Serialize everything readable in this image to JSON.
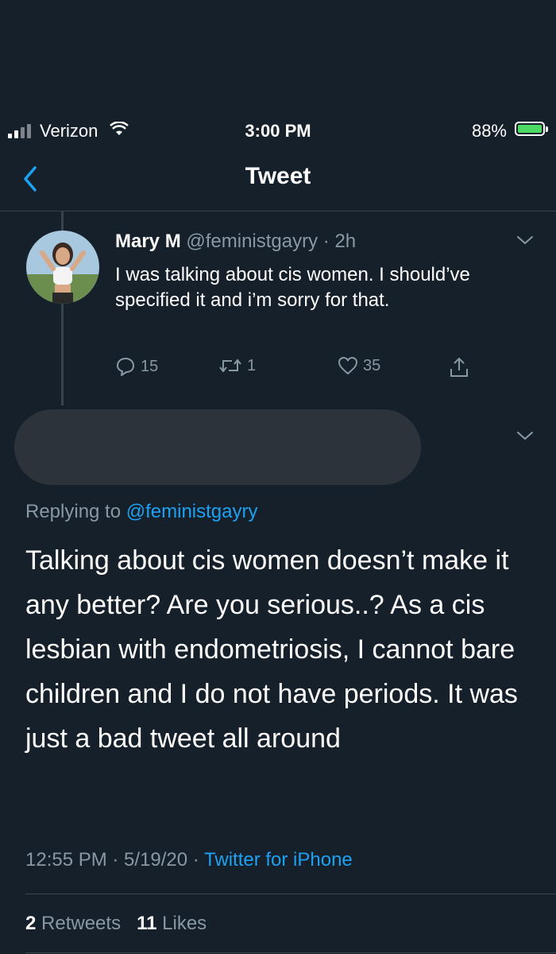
{
  "status_bar": {
    "carrier": "Verizon",
    "time": "3:00 PM",
    "battery": "88%",
    "battery_level": 0.88
  },
  "nav": {
    "title": "Tweet",
    "back_icon": "chevron-left-icon"
  },
  "parent_tweet": {
    "display_name": "Mary M",
    "handle": "@feministgayry",
    "separator": " · ",
    "age": "2h",
    "text": "I was talking about cis women. I should’ve specified it and i’m sorry for that.",
    "replies": "15",
    "retweets": "1",
    "likes": "35"
  },
  "reply_tweet": {
    "replying_prefix": "Replying to ",
    "replying_handle": "@feministgayry",
    "text": "Talking about cis women doesn’t make it any better? Are you serious..? As a cis lesbian with endometriosis, I cannot bare children and I do not have periods. It was just a bad tweet all around",
    "timestamp": "12:55 PM · 5/19/20 · ",
    "source": "Twitter for iPhone",
    "retweet_count": "2",
    "retweet_label": "Retweets",
    "like_count": "11",
    "like_label": "Likes"
  },
  "colors": {
    "background": "#15202b",
    "accent": "#1da1f2",
    "muted": "#8899a6",
    "divider": "#38444d"
  }
}
